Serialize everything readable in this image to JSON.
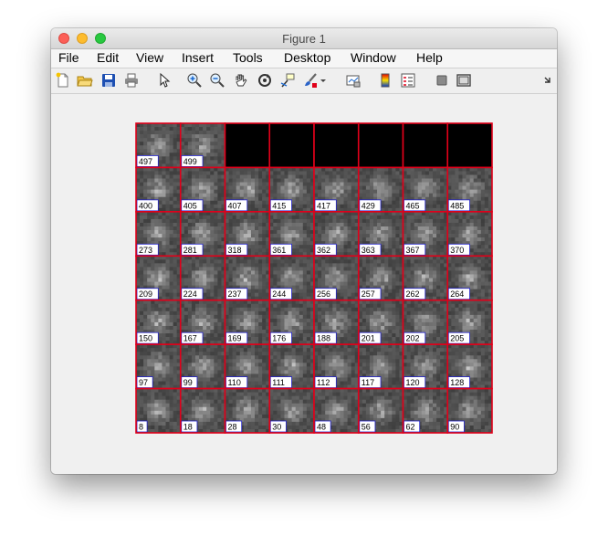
{
  "window": {
    "title": "Figure 1"
  },
  "menu": [
    "File",
    "Edit",
    "View",
    "Insert",
    "Tools",
    "Desktop",
    "Window",
    "Help"
  ],
  "toolbar": [
    "new-figure-icon",
    "open-file-icon",
    "save-icon",
    "print-icon",
    "pointer-icon",
    "zoom-in-icon",
    "zoom-out-icon",
    "pan-hand-icon",
    "rotate-3d-icon",
    "data-cursor-icon",
    "brush-icon",
    "brush-dropdown-icon",
    "link-plot-icon",
    "colorbar-icon",
    "legend-icon",
    "hide-plot-tools-icon",
    "show-plot-tools-icon",
    "toolbar-overflow-icon"
  ],
  "montage": {
    "border_color": "#e0001a",
    "label_border_color": "#2020c8",
    "rows": [
      [
        "497",
        "499",
        "",
        "",
        "",
        "",
        "",
        ""
      ],
      [
        "400",
        "405",
        "407",
        "415",
        "417",
        "429",
        "465",
        "485"
      ],
      [
        "273",
        "281",
        "318",
        "361",
        "362",
        "363",
        "367",
        "370"
      ],
      [
        "209",
        "224",
        "237",
        "244",
        "256",
        "257",
        "262",
        "264"
      ],
      [
        "150",
        "167",
        "169",
        "176",
        "188",
        "201",
        "202",
        "205"
      ],
      [
        "97",
        "99",
        "110",
        "111",
        "112",
        "117",
        "120",
        "128"
      ],
      [
        "8",
        "18",
        "28",
        "30",
        "48",
        "56",
        "62",
        "90"
      ]
    ]
  }
}
